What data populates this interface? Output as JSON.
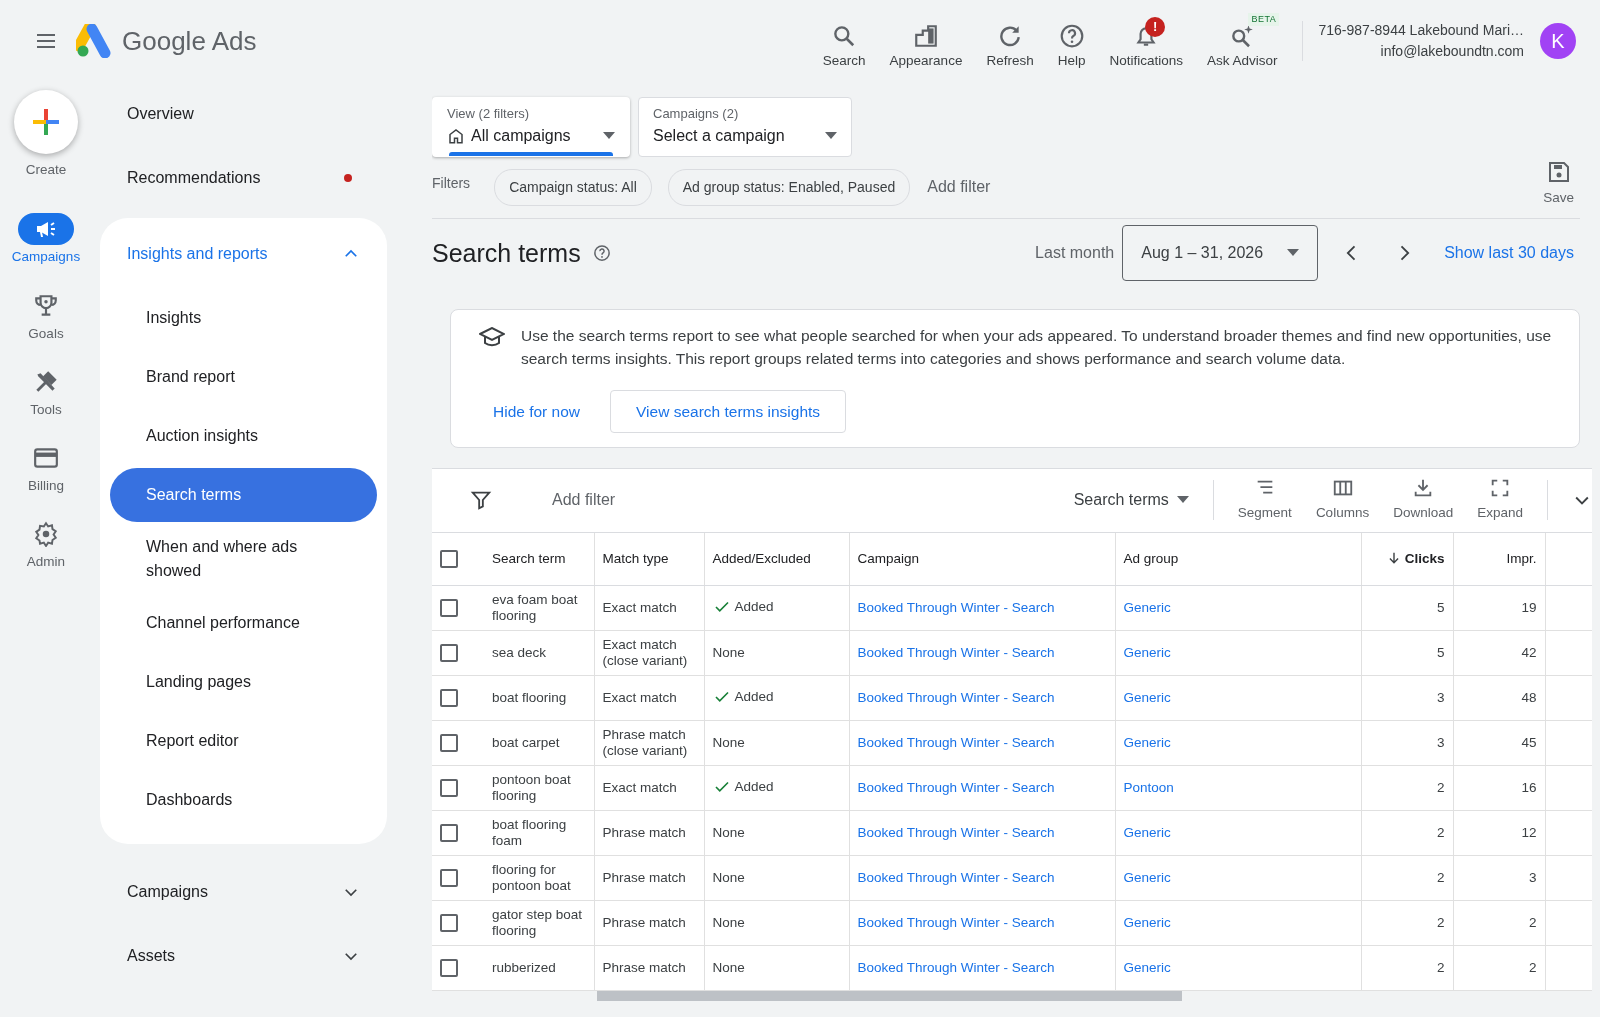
{
  "header": {
    "product_name": "Google Ads",
    "tools": [
      {
        "label": "Search"
      },
      {
        "label": "Appearance"
      },
      {
        "label": "Refresh"
      },
      {
        "label": "Help"
      },
      {
        "label": "Notifications",
        "badge": "!"
      },
      {
        "label": "Ask Advisor",
        "tag": "BETA"
      }
    ],
    "account": {
      "name": "716-987-8944 Lakebound Mari…",
      "email": "info@lakeboundtn.com",
      "avatar_letter": "K"
    }
  },
  "rail": {
    "create": "Create",
    "items": [
      {
        "label": "Campaigns",
        "selected": true
      },
      {
        "label": "Goals",
        "selected": false
      },
      {
        "label": "Tools",
        "selected": false
      },
      {
        "label": "Billing",
        "selected": false
      },
      {
        "label": "Admin",
        "selected": false
      }
    ]
  },
  "nav": [
    {
      "kind": "link",
      "label": "Overview",
      "notification_dot": false
    },
    {
      "kind": "link",
      "label": "Recommendations",
      "notification_dot": true
    },
    {
      "kind": "group",
      "label": "Insights and reports",
      "expanded": true,
      "children": [
        {
          "label": "Insights",
          "selected": false
        },
        {
          "label": "Brand report",
          "selected": false
        },
        {
          "label": "Auction insights",
          "selected": false
        },
        {
          "label": "Search terms",
          "selected": true
        },
        {
          "label": "When and where ads showed",
          "selected": false
        },
        {
          "label": "Channel performance",
          "selected": false
        },
        {
          "label": "Landing pages",
          "selected": false
        },
        {
          "label": "Report editor",
          "selected": false
        },
        {
          "label": "Dashboards",
          "selected": false
        }
      ]
    },
    {
      "kind": "group",
      "label": "Campaigns",
      "expanded": false
    },
    {
      "kind": "group",
      "label": "Assets",
      "expanded": false
    }
  ],
  "pickers": [
    {
      "label": "View (2 filters)",
      "value": "All campaigns",
      "selected": true
    },
    {
      "label": "Campaigns (2)",
      "value": "Select a campaign",
      "selected": false
    }
  ],
  "filters": {
    "label": "Filters",
    "chips": [
      "Campaign status: All",
      "Ad group status: Enabled, Paused"
    ],
    "add": "Add filter",
    "save": "Save"
  },
  "title": "Search terms",
  "date": {
    "preset": "Last month",
    "range": "Aug 1 – 31, 2026",
    "shortcut": "Show last 30 days"
  },
  "banner": {
    "text": "Use the search terms report to see what people searched for when your ads appeared. To understand broader themes and find new opportunities, use search terms insights. This report groups related terms into categories and shows performance and search volume data.",
    "dismiss": "Hide for now",
    "action": "View search terms insights"
  },
  "toolbar": {
    "add_filter": "Add filter",
    "view": "Search terms",
    "actions": [
      "Segment",
      "Columns",
      "Download",
      "Expand"
    ]
  },
  "table": {
    "all_checked": false,
    "columns": [
      {
        "label": "Search term",
        "kind": "text",
        "sorted": false
      },
      {
        "label": "Match type",
        "kind": "text",
        "sorted": false
      },
      {
        "label": "Added/Excluded",
        "kind": "status",
        "sorted": false
      },
      {
        "label": "Campaign",
        "kind": "link",
        "sorted": false
      },
      {
        "label": "Ad group",
        "kind": "link",
        "sorted": false
      },
      {
        "label": "Clicks",
        "kind": "number",
        "sorted": true
      },
      {
        "label": "Impr.",
        "kind": "number",
        "sorted": false
      }
    ],
    "rows": [
      {
        "checked": false,
        "added": true,
        "cells": [
          "eva foam boat flooring",
          "Exact match",
          "Added",
          "Booked Through Winter - Search",
          "Generic",
          "5",
          "19"
        ]
      },
      {
        "checked": false,
        "added": false,
        "cells": [
          "sea deck",
          "Exact match (close variant)",
          "None",
          "Booked Through Winter - Search",
          "Generic",
          "5",
          "42"
        ]
      },
      {
        "checked": false,
        "added": true,
        "cells": [
          "boat flooring",
          "Exact match",
          "Added",
          "Booked Through Winter - Search",
          "Generic",
          "3",
          "48"
        ]
      },
      {
        "checked": false,
        "added": false,
        "cells": [
          "boat carpet",
          "Phrase match (close variant)",
          "None",
          "Booked Through Winter - Search",
          "Generic",
          "3",
          "45"
        ]
      },
      {
        "checked": false,
        "added": true,
        "cells": [
          "pontoon boat flooring",
          "Exact match",
          "Added",
          "Booked Through Winter - Search",
          "Pontoon",
          "2",
          "16"
        ]
      },
      {
        "checked": false,
        "added": false,
        "cells": [
          "boat flooring foam",
          "Phrase match",
          "None",
          "Booked Through Winter - Search",
          "Generic",
          "2",
          "12"
        ]
      },
      {
        "checked": false,
        "added": false,
        "cells": [
          "flooring for pontoon boat",
          "Phrase match",
          "None",
          "Booked Through Winter - Search",
          "Generic",
          "2",
          "3"
        ]
      },
      {
        "checked": false,
        "added": false,
        "cells": [
          "gator step boat flooring",
          "Phrase match",
          "None",
          "Booked Through Winter - Search",
          "Generic",
          "2",
          "2"
        ]
      },
      {
        "checked": false,
        "added": false,
        "cells": [
          "rubberized",
          "Phrase match",
          "None",
          "Booked Through Winter - Search",
          "Generic",
          "2",
          "2"
        ]
      }
    ]
  }
}
